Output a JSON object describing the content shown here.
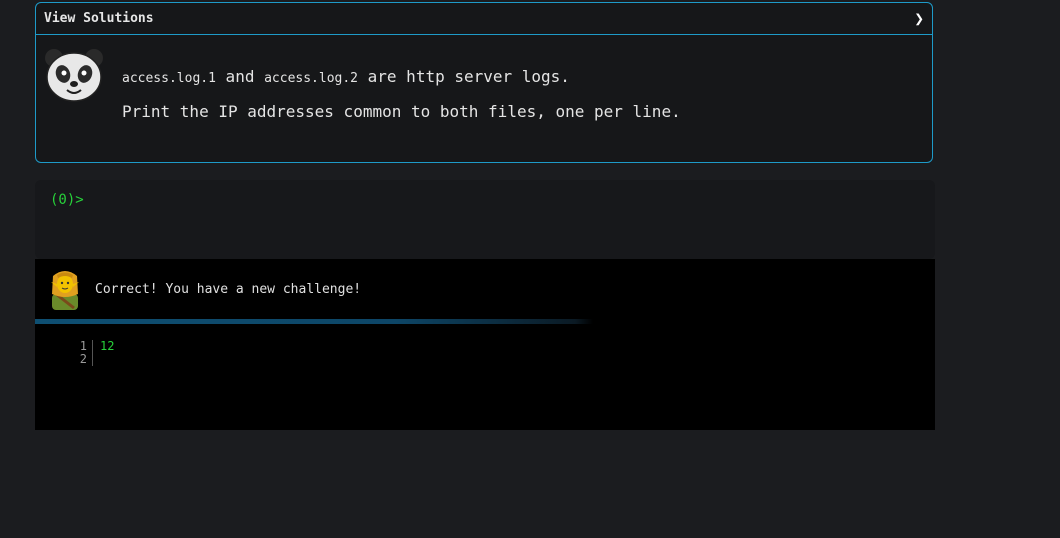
{
  "header": {
    "title": "View Solutions",
    "toggle_glyph": "❯",
    "toggle_icon": "chevron-right-icon"
  },
  "problem": {
    "file1": "access.log.1",
    "and_text": " and ",
    "file2": "access.log.2",
    "rest_text": " are http server logs.",
    "line2": "Print the IP addresses common to both files, one per line."
  },
  "terminal": {
    "prompt": "(0)>"
  },
  "feedback": {
    "message": "Correct! You have a new challenge!",
    "line_numbers": "1\n2",
    "output": "12"
  },
  "colors": {
    "accent": "#1e9ac8",
    "prompt_green": "#27d13a",
    "background": "#1b1c1f"
  }
}
